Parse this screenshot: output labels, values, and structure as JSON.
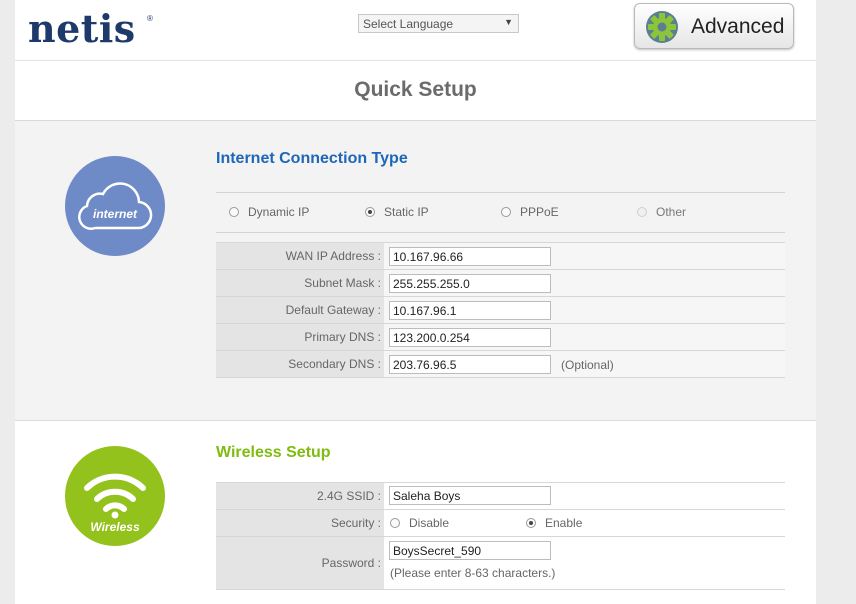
{
  "header": {
    "logo_text": "netis",
    "logo_reg": "®",
    "language_select": "Select Language",
    "advanced_button": "Advanced"
  },
  "page_title": "Quick Setup",
  "internet": {
    "section_title": "Internet Connection Type",
    "icon_label": "internet",
    "connection_types": [
      {
        "label": "Dynamic IP",
        "selected": false,
        "disabled": false
      },
      {
        "label": "Static IP",
        "selected": true,
        "disabled": false
      },
      {
        "label": "PPPoE",
        "selected": false,
        "disabled": false
      },
      {
        "label": "Other",
        "selected": false,
        "disabled": true
      }
    ],
    "fields": [
      {
        "label": "WAN IP Address :",
        "value": "10.167.96.66"
      },
      {
        "label": "Subnet Mask :",
        "value": "255.255.255.0"
      },
      {
        "label": "Default Gateway :",
        "value": "10.167.96.1"
      },
      {
        "label": "Primary DNS :",
        "value": "123.200.0.254"
      },
      {
        "label": "Secondary DNS :",
        "value": "203.76.96.5",
        "note": "(Optional)"
      }
    ]
  },
  "wireless": {
    "section_title": "Wireless Setup",
    "icon_label": "Wireless",
    "ssid_label": "2.4G SSID :",
    "ssid_value": "Saleha Boys",
    "security_label": "Security :",
    "security_options": [
      {
        "label": "Disable",
        "selected": false
      },
      {
        "label": "Enable",
        "selected": true
      }
    ],
    "password_label": "Password :",
    "password_value": "BoysSecret_590",
    "password_hint": "(Please enter 8-63 characters.)"
  },
  "colors": {
    "brand_navy": "#1d3a6b",
    "internet_blue": "#1e66b8",
    "internet_circle": "#6e8bc8",
    "wireless_green": "#7fbb10",
    "wireless_circle": "#93c21d"
  }
}
